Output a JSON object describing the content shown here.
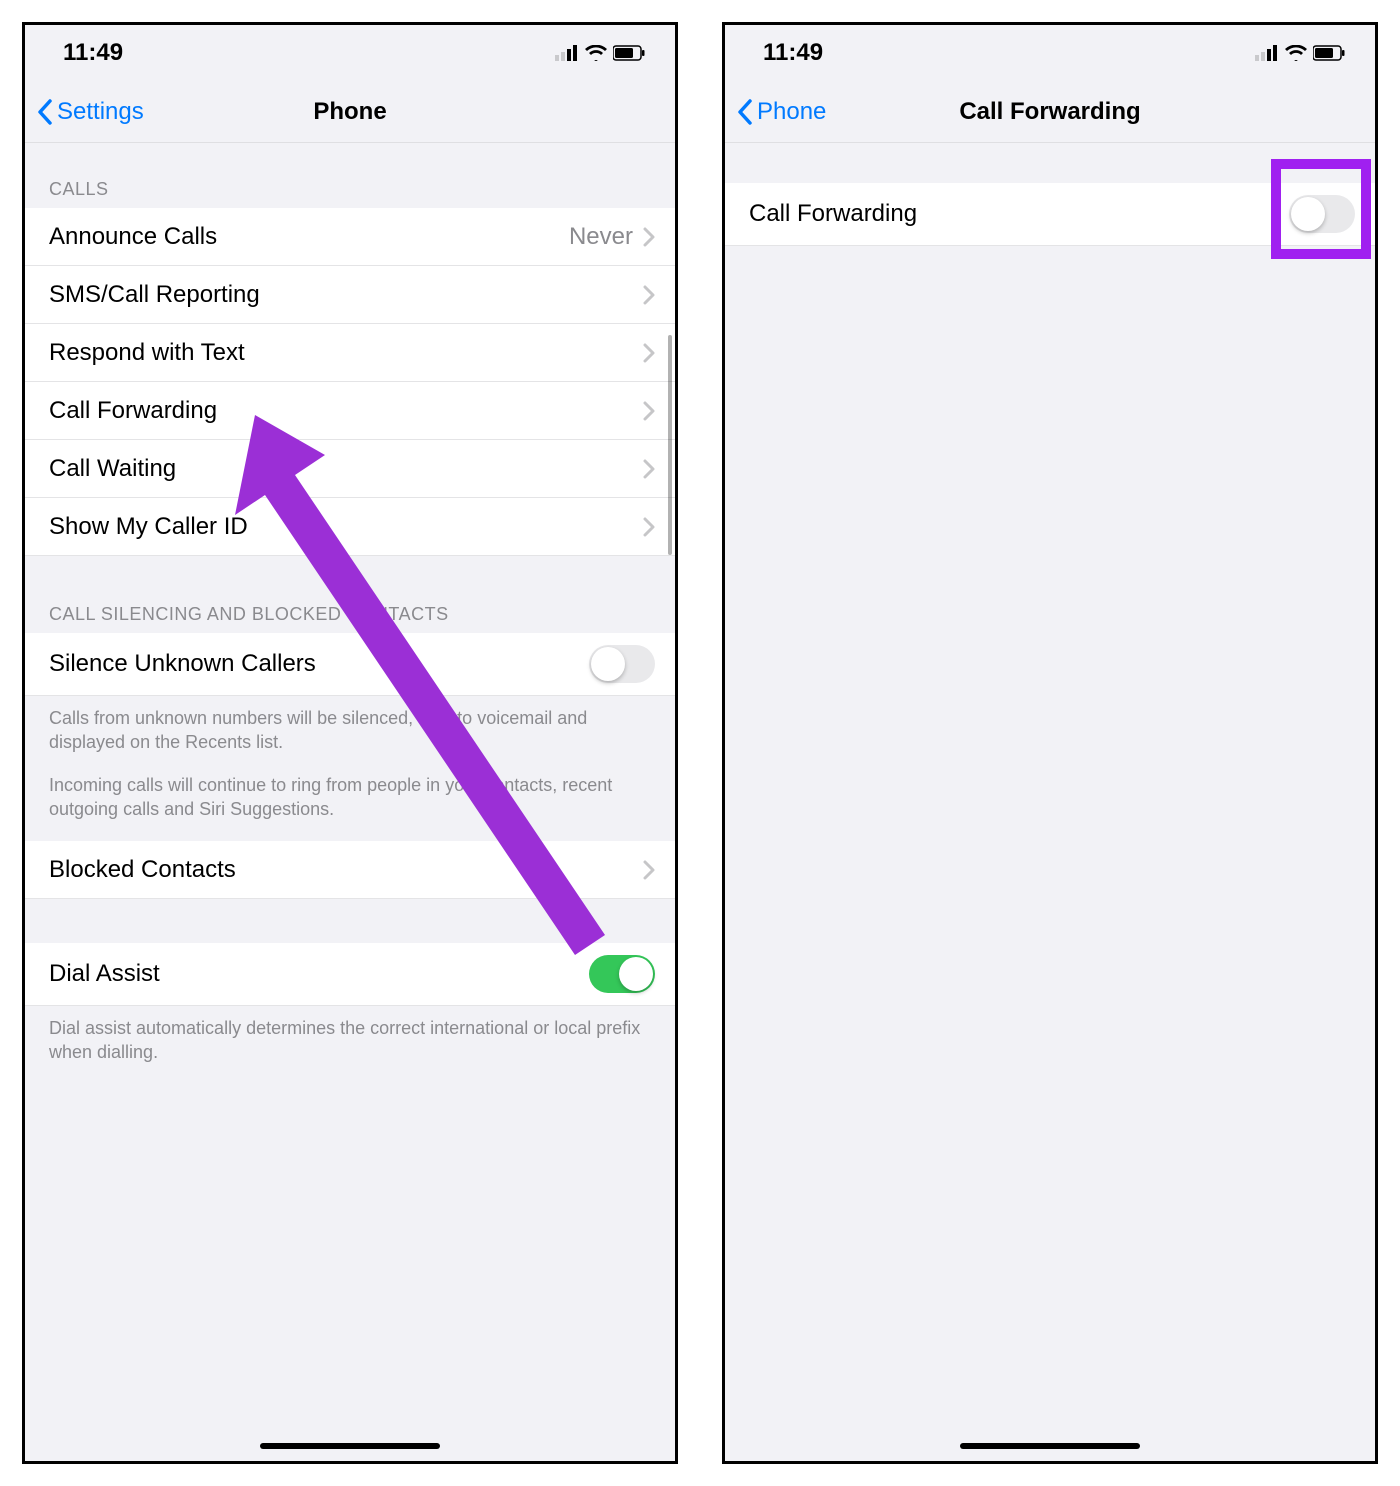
{
  "left": {
    "status_time": "11:49",
    "nav_back": "Settings",
    "nav_title": "Phone",
    "section_calls": "CALLS",
    "rows_calls": [
      {
        "label": "Announce Calls",
        "value": "Never"
      },
      {
        "label": "SMS/Call Reporting"
      },
      {
        "label": "Respond with Text"
      },
      {
        "label": "Call Forwarding"
      },
      {
        "label": "Call Waiting"
      },
      {
        "label": "Show My Caller ID"
      }
    ],
    "section_silencing": "CALL SILENCING AND BLOCKED CONTACTS",
    "silence_label": "Silence Unknown Callers",
    "silence_on": false,
    "silence_note1": "Calls from unknown numbers will be silenced, sent to voicemail and displayed on the Recents list.",
    "silence_note2": "Incoming calls will continue to ring from people in your contacts, recent outgoing calls and Siri Suggestions.",
    "blocked_label": "Blocked Contacts",
    "dial_assist_label": "Dial Assist",
    "dial_assist_on": true,
    "dial_assist_note": "Dial assist automatically determines the correct international or local prefix when dialling."
  },
  "right": {
    "status_time": "11:49",
    "nav_back": "Phone",
    "nav_title": "Call Forwarding",
    "row_label": "Call Forwarding",
    "toggle_on": false
  }
}
